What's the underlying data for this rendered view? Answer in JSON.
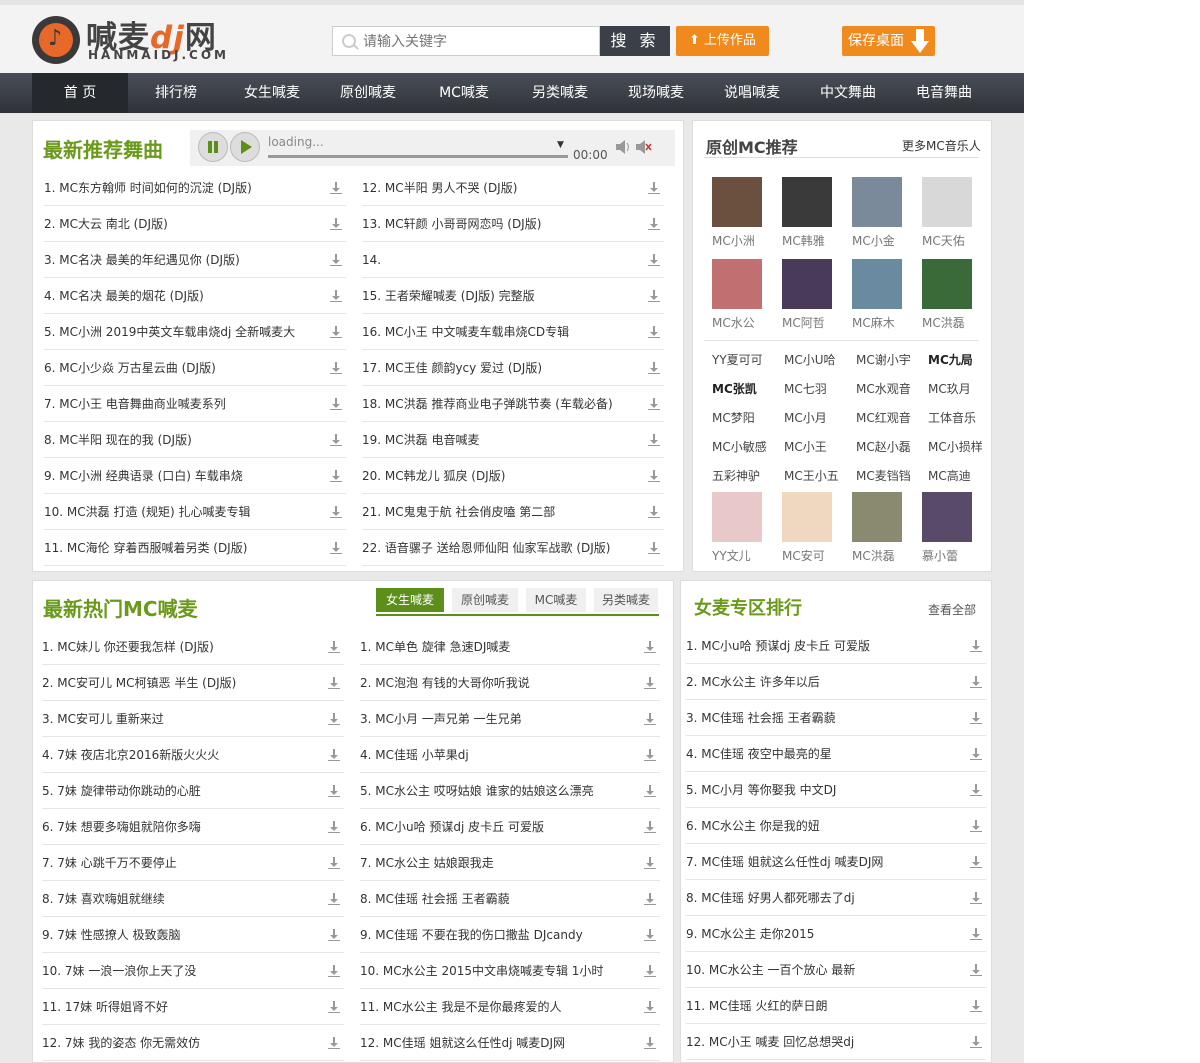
{
  "header": {
    "logo_brand": "喊麦",
    "logo_dj": "dj",
    "logo_net": "网",
    "logo_domain": "HANMAIDJ.COM",
    "search_placeholder": "请输入关键字",
    "search_label": "搜 索",
    "upload_label": "上传作品",
    "save_label": "保存桌面"
  },
  "nav": [
    "首 页",
    "排行榜",
    "女生喊麦",
    "原创喊麦",
    "MC喊麦",
    "另类喊麦",
    "现场喊麦",
    "说唱喊麦",
    "中文舞曲",
    "电音舞曲"
  ],
  "recommend": {
    "title": "最新推荐舞曲",
    "player_status": "loading...",
    "player_time": "00:00",
    "left": [
      "1. MC东方翰师 时间如何的沉淀 (DJ版)",
      "2. MC大云 南北 (DJ版)",
      "3. MC名决 最美的年纪遇见你 (DJ版)",
      "4. MC名决 最美的烟花 (DJ版)",
      "5. MC小洲 2019中英文车载串烧dj 全新喊麦大",
      "6. MC小少焱 万古星云曲 (DJ版)",
      "7. MC小王 电音舞曲商业喊麦系列",
      "8. MC半阳 现在的我 (DJ版)",
      "9. MC小洲 经典语录 (口白) 车载串烧",
      "10. MC洪磊 打造 (规矩) 扎心喊麦专辑",
      "11. MC海伦 穿着西服喊着另类 (DJ版)"
    ],
    "right": [
      "12. MC半阳 男人不哭 (DJ版)",
      "13. MC轩颜 小哥哥网恋吗 (DJ版)",
      "14.",
      "15. 王者荣耀喊麦 (DJ版) 完整版",
      "16. MC小王 中文喊麦车载串烧CD专辑",
      "17. MC王佳 颜韵ycy 爱过 (DJ版)",
      "18. MC洪磊 推荐商业电子弹跳节奏 (车载必备)",
      "19. MC洪磊 电音喊麦",
      "20. MC韩龙儿 狐戾 (DJ版)",
      "21. MC鬼鬼于航 社会俏皮嗑 第二部",
      "22. 语音骡子 送给恩师仙阳 仙家军战歌 (DJ版)"
    ]
  },
  "original": {
    "title": "原创MC推荐",
    "more": "更多MC音乐人",
    "artists_row1": [
      "MC小洲",
      "MC韩雅",
      "MC小金",
      "MC天佑"
    ],
    "artists_row2": [
      "MC水公",
      "MC阿哲",
      "MC麻木",
      "MC洪磊"
    ],
    "tags": [
      [
        "YY夏可可",
        "MC小U哈",
        "MC谢小宇",
        "MC九局"
      ],
      [
        "MC张凯",
        "MC七羽",
        "MC水观音",
        "MC玖月"
      ],
      [
        "MC梦阳",
        "MC小月",
        "MC红观音",
        "工体音乐"
      ],
      [
        "MC小敏感",
        "MC小王",
        "MC赵小磊",
        "MC小损样"
      ],
      [
        "五彩神驴",
        "MC王小五",
        "MC麦铛铛",
        "MC高迪"
      ]
    ],
    "artists_row3": [
      "YY文儿",
      "MC安可",
      "MC洪磊",
      "慕小蕾"
    ]
  },
  "hot": {
    "title": "最新热门MC喊麦",
    "tabs": [
      "女生喊麦",
      "原创喊麦",
      "MC喊麦",
      "另类喊麦"
    ],
    "left": [
      "1. MC妹儿 你还要我怎样 (DJ版)",
      "2. MC安可儿 MC柯镇恶 半生 (DJ版)",
      "3. MC安可儿 重新来过",
      "4. 7妹 夜店北京2016新版火火火",
      "5. 7妹 旋律带动你跳动的心脏",
      "6. 7妹 想要多嗨姐就陪你多嗨",
      "7. 7妹 心跳千万不要停止",
      "8. 7妹 喜欢嗨姐就继续",
      "9. 7妹 性感撩人 极致轰脑",
      "10. 7妹 一浪一浪你上天了没",
      "11. 17妹 听得姐肾不好",
      "12. 7妹 我的姿态 你无需效仿"
    ],
    "right": [
      "1. MC单色 旋律 急速DJ喊麦",
      "2. MC泡泡 有钱的大哥你听我说",
      "3. MC小月 一声兄弟 一生兄弟",
      "4. MC佳瑶 小苹果dj",
      "5. MC水公主 哎呀姑娘 谁家的姑娘这么漂亮",
      "6. MC小u哈 预谋dj 皮卡丘 可爱版",
      "7. MC水公主 姑娘跟我走",
      "8. MC佳瑶 社会摇 王者霸藐",
      "9. MC佳瑶 不要在我的伤口撒盐 DJcandy",
      "10. MC水公主 2015中文串烧喊麦专辑 1小时",
      "11. MC水公主 我是不是你最疼爱的人",
      "12. MC佳瑶 姐就这么任性dj 喊麦DJ网"
    ]
  },
  "female_rank": {
    "title": "女麦专区排行",
    "more": "查看全部",
    "items": [
      "1. MC小u哈 预谋dj 皮卡丘 可爱版",
      "2. MC水公主 许多年以后",
      "3. MC佳瑶 社会摇 王者霸藐",
      "4. MC佳瑶 夜空中最亮的星",
      "5. MC小月 等你娶我 中文DJ",
      "6. MC水公主 你是我的妞",
      "7. MC佳瑶 姐就这么任性dj 喊麦DJ网",
      "8. MC佳瑶 好男人都死哪去了dj",
      "9. MC水公主 走你2015",
      "10. MC水公主 一百个放心 最新",
      "11. MC佳瑶 火红的萨日朗",
      "12. MC小王 喊麦 回忆总想哭dj"
    ]
  }
}
